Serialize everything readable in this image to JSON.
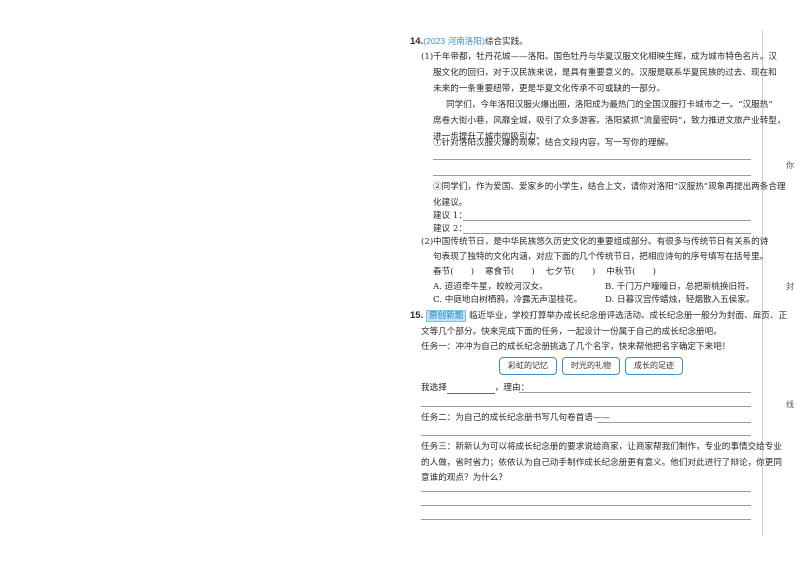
{
  "q14": {
    "num": "14.",
    "source": "(2023 河南洛阳)",
    "title": "综合实践。",
    "p1": [
      "(1)千年帝都，牡丹花城——洛阳。国色牡丹与华夏汉服文化相映生辉，成为城市特色名片。汉",
      "服文化的回归，对于汉民族来说，是具有重要意义的。汉服是联系华夏民族的过去、现在和",
      "未来的一条重要纽带，更是华夏文化传承不可或缺的一部分。"
    ],
    "p2": [
      "同学们，今年洛阳汉服火爆出圈，洛阳成为最热门的全国汉服打卡城市之一。“汉服热”",
      "席卷大街小巷，风靡全城，吸引了众多游客。洛阳紧抓“流量密码”，致力推进文旅产业转型，",
      "进一步提升了城市的吸引力。"
    ],
    "q1": "①针对洛阳汉服火爆的现象，结合文段内容，写一写你的理解。",
    "q2": [
      "②同学们，作为爱国、爱家乡的小学生，结合上文，请你对洛阳“汉服热”现象再提出两条合理",
      "化建议。"
    ],
    "s1": "建议 1：",
    "s2": "建议 2：",
    "p3": [
      "(2)中国传统节日，是中华民族悠久历史文化的重要组成部分。有很多与传统节日有关系的诗",
      "句表现了独特的文化内涵，对应下面的几个传统节日，把相应诗句的序号填写在括号里。"
    ],
    "festivals": [
      "春节(　　)",
      "寒食节(　　)",
      "七夕节(　　)",
      "中秋节(　　)"
    ],
    "options": [
      "A. 迢迢牵牛星，皎皎河汉女。",
      "B. 千门万户曈曈日，总把新桃换旧符。",
      "C. 中庭地白树栖鸦，冷露无声湿桂花。",
      "D. 日暮汉宫传蜡烛，轻烟散入五侯家。"
    ]
  },
  "q15": {
    "num": "15.",
    "tag": "原创新题",
    "p1": [
      "临近毕业，学校打算举办成长纪念册评选活动。成长纪念册一般分为封面、扉页、正",
      "文等几个部分。快来完成下面的任务，一起设计一份属于自己的成长纪念册吧。"
    ],
    "task1": "任务一：冲冲为自己的成长纪念册挑选了几个名字，快来帮他把名字确定下来吧！",
    "names": [
      "彩虹的记忆",
      "时光的礼物",
      "成长的足迹"
    ],
    "choose": "我选择",
    "reason": "，理由：",
    "task2": "任务二：为自己的成长纪念册书写几句卷首语——",
    "task3": [
      "任务三：新新认为可以将成长纪念册的要求说给商家，让商家帮我们制作，专业的事情交给专业",
      "的人做，省时省力；依依认为自己动手制作成长纪念册更有意义。他们对此进行了辩论，你更同",
      "意谁的观点？为什么？"
    ]
  },
  "margin": [
    "你",
    "封",
    "线"
  ]
}
